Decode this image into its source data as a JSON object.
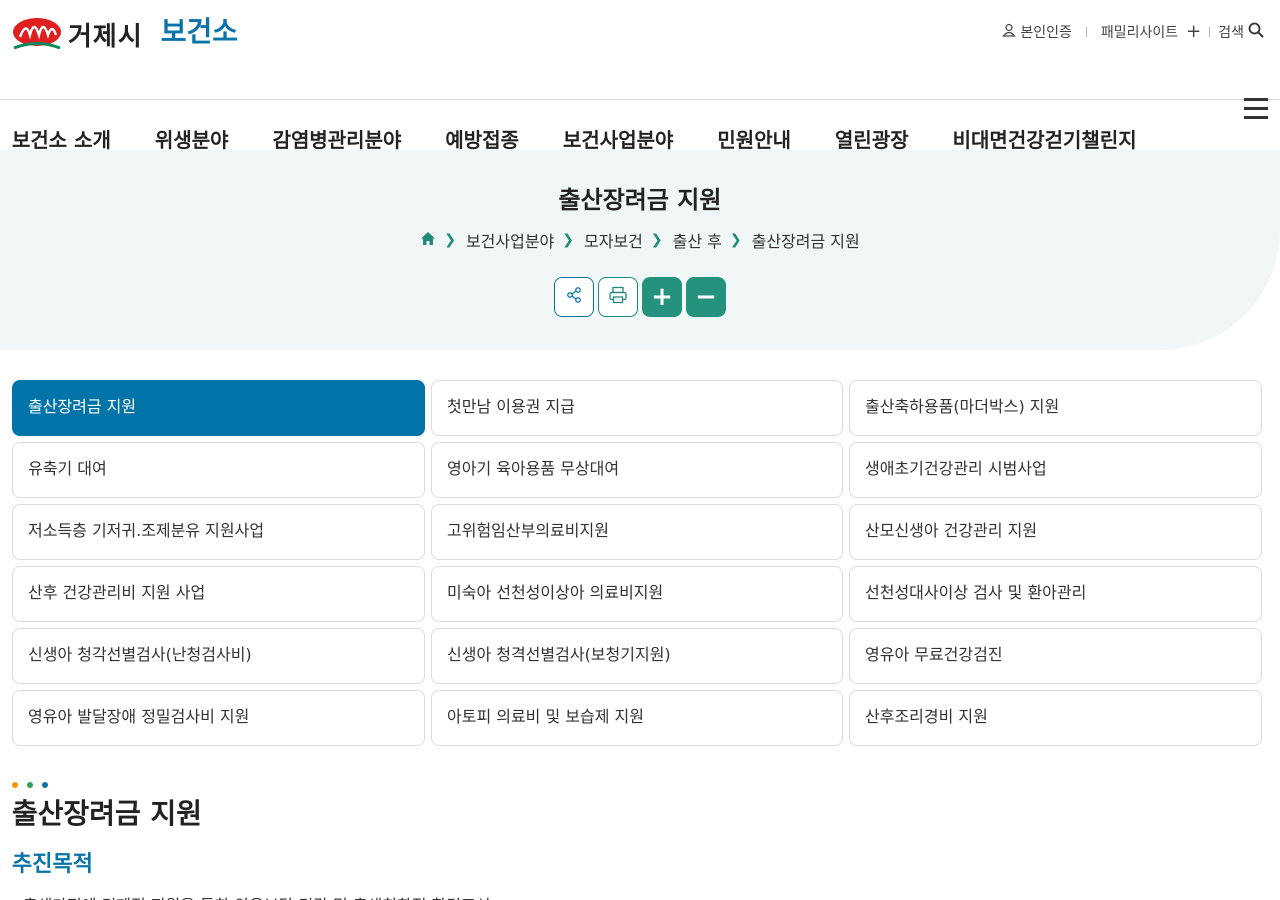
{
  "header": {
    "logo_text": "거제시",
    "logo_sub": "보건소",
    "util": {
      "auth_label": "본인인증",
      "family_label": "패밀리사이트",
      "search_label": "검색"
    }
  },
  "gnb": {
    "items": [
      "보건소 소개",
      "위생분야",
      "감염병관리분야",
      "예방접종",
      "보건사업분야",
      "민원안내",
      "열린광장",
      "비대면건강걷기챌린지"
    ]
  },
  "subvisual": {
    "title": "출산장려금 지원",
    "breadcrumb": [
      "보건사업분야",
      "모자보건",
      "출산 후",
      "출산장려금 지원"
    ],
    "tools": {
      "zoom_in": "+",
      "zoom_out": "−"
    }
  },
  "tabs": [
    "출산장려금 지원",
    "첫만남 이용권 지급",
    "출산축하용품(마더박스) 지원",
    "유축기 대여",
    "영아기 육아용품 무상대여",
    "생애초기건강관리 시범사업",
    "저소득층 기저귀.조제분유 지원사업",
    "고위험임산부의료비지원",
    "산모신생아 건강관리 지원",
    "산후 건강관리비 지원 사업",
    "미숙아 선천성이상아 의료비지원",
    "선천성대사이상 검사 및 환아관리",
    "신생아 청각선별검사(난청검사비)",
    "신생아 청격선별검사(보청기지원)",
    "영유아 무료건강검진",
    "영유아 발달장애 정밀검사비 지원",
    "아토피 의료비 및 보습제 지원",
    "산후조리경비 지원"
  ],
  "content": {
    "title": "출산장려금 지원",
    "section_title": "추진목적",
    "body_line": "- 출생가정에 경제적 지원을 통한 양육부담 경감 및 출생친화적 환경조성"
  },
  "colors": {
    "brand_blue": "#0073a8",
    "brand_green": "#25927e",
    "dot_orange": "#f39800",
    "dot_green": "#2aa05a",
    "dot_blue": "#0a74a8"
  }
}
